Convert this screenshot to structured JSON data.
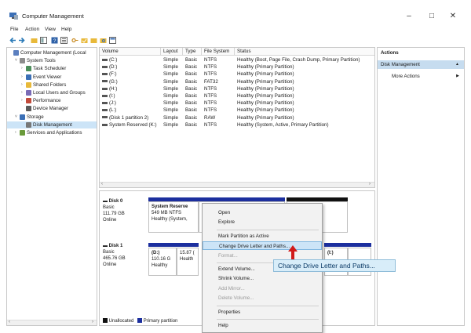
{
  "window": {
    "title": "Computer Management",
    "controls": {
      "minimize": "–",
      "maximize": "□",
      "close": "✕"
    }
  },
  "menu": [
    "File",
    "Action",
    "View",
    "Help"
  ],
  "tree": [
    {
      "label": "Computer Management (Local",
      "indent": 0,
      "twisty": "",
      "icon": "computer-icon"
    },
    {
      "label": "System Tools",
      "indent": 1,
      "twisty": "˅",
      "icon": "tools-icon"
    },
    {
      "label": "Task Scheduler",
      "indent": 2,
      "twisty": "›",
      "icon": "clock-icon"
    },
    {
      "label": "Event Viewer",
      "indent": 2,
      "twisty": "›",
      "icon": "event-icon"
    },
    {
      "label": "Shared Folders",
      "indent": 2,
      "twisty": "›",
      "icon": "folder-icon"
    },
    {
      "label": "Local Users and Groups",
      "indent": 2,
      "twisty": "›",
      "icon": "users-icon"
    },
    {
      "label": "Performance",
      "indent": 2,
      "twisty": "›",
      "icon": "performance-icon"
    },
    {
      "label": "Device Manager",
      "indent": 2,
      "twisty": "",
      "icon": "device-icon"
    },
    {
      "label": "Storage",
      "indent": 1,
      "twisty": "˅",
      "icon": "storage-icon"
    },
    {
      "label": "Disk Management",
      "indent": 2,
      "twisty": "",
      "icon": "disk-icon",
      "selected": true
    },
    {
      "label": "Services and Applications",
      "indent": 1,
      "twisty": "›",
      "icon": "services-icon"
    }
  ],
  "volumes": {
    "headers": [
      "Volume",
      "Layout",
      "Type",
      "File System",
      "Status"
    ],
    "rows": [
      [
        "(C:)",
        "Simple",
        "Basic",
        "NTFS",
        "Healthy (Boot, Page File, Crash Dump, Primary Partition)"
      ],
      [
        "(D:)",
        "Simple",
        "Basic",
        "NTFS",
        "Healthy (Primary Partition)"
      ],
      [
        "(F:)",
        "Simple",
        "Basic",
        "NTFS",
        "Healthy (Primary Partition)"
      ],
      [
        "(G:)",
        "Simple",
        "Basic",
        "FAT32",
        "Healthy (Primary Partition)"
      ],
      [
        "(H:)",
        "Simple",
        "Basic",
        "NTFS",
        "Healthy (Primary Partition)"
      ],
      [
        "(I:)",
        "Simple",
        "Basic",
        "NTFS",
        "Healthy (Primary Partition)"
      ],
      [
        "(J:)",
        "Simple",
        "Basic",
        "NTFS",
        "Healthy (Primary Partition)"
      ],
      [
        "(L:)",
        "Simple",
        "Basic",
        "NTFS",
        "Healthy (Primary Partition)"
      ],
      [
        "(Disk 1 partition 2)",
        "Simple",
        "Basic",
        "RAW",
        "Healthy (Primary Partition)"
      ],
      [
        "System Reserved (K:)",
        "Simple",
        "Basic",
        "NTFS",
        "Healthy (System, Active, Primary Partition)"
      ]
    ]
  },
  "disks": [
    {
      "name": "Disk 0",
      "type": "Basic",
      "size": "111.79 GB",
      "status": "Online",
      "partition": {
        "name": "System Reserve",
        "size": "549 MB NTFS",
        "status": "Healthy (System,"
      }
    },
    {
      "name": "Disk 1",
      "type": "Basic",
      "size": "465.76 GB",
      "status": "Online",
      "partitions": [
        {
          "name": "(D:)",
          "size": "110.16 G",
          "status": "Healthy"
        },
        {
          "name": "",
          "size": "15.87 (",
          "status": "Health"
        },
        {
          "name": "(I:)",
          "size": "",
          "status": ""
        }
      ]
    }
  ],
  "legend": {
    "unallocated": "Unallocated",
    "primary": "Primary partition"
  },
  "context_menu": [
    {
      "label": "Open",
      "disabled": false
    },
    {
      "label": "Explore",
      "disabled": false
    },
    {
      "sep": true
    },
    {
      "label": "Mark Partition as Active",
      "disabled": false
    },
    {
      "label": "Change Drive Letter and Paths...",
      "disabled": false,
      "highlighted": true
    },
    {
      "label": "Format...",
      "disabled": true
    },
    {
      "sep": true
    },
    {
      "label": "Extend Volume...",
      "disabled": false
    },
    {
      "label": "Shrink Volume...",
      "disabled": false
    },
    {
      "label": "Add Mirror...",
      "disabled": true
    },
    {
      "label": "Delete Volume...",
      "disabled": true
    },
    {
      "sep": true
    },
    {
      "label": "Properties",
      "disabled": false
    },
    {
      "sep": true
    },
    {
      "label": "Help",
      "disabled": false
    }
  ],
  "tooltip": "Change Drive Letter and Paths...",
  "actions": {
    "header": "Actions",
    "section": "Disk Management",
    "more": "More Actions"
  },
  "colors": {
    "primary_partition": "#1c2f9e",
    "unallocated": "#111111",
    "selection": "#cce4f7",
    "arrow": "#d11a1a"
  }
}
